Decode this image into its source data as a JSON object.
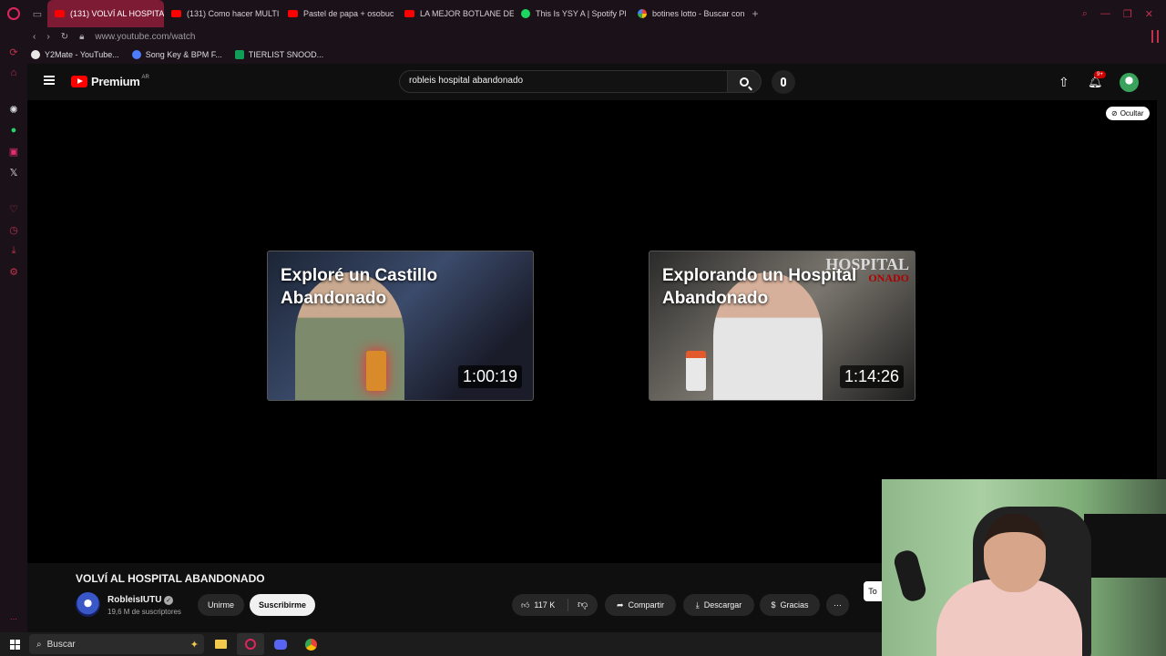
{
  "browser": {
    "tabs": [
      {
        "label": "(131) VOLVÍ AL HOSPITAL",
        "favicon": "youtube-icon",
        "active": true
      },
      {
        "label": "(131) Como hacer MULTI",
        "favicon": "youtube-icon",
        "active": false
      },
      {
        "label": "Pastel de papa + osobuc",
        "favicon": "youtube-icon",
        "active": false
      },
      {
        "label": "LA MEJOR BOTLANE DE",
        "favicon": "youtube-icon",
        "active": false
      },
      {
        "label": "This Is YSY A | Spotify Pl",
        "favicon": "spotify-icon",
        "active": false
      },
      {
        "label": "botines lotto - Buscar con",
        "favicon": "google-icon",
        "active": false
      }
    ],
    "url": "www.youtube.com/watch",
    "bookmarks": [
      {
        "label": "Y2Mate - YouTube..."
      },
      {
        "label": "Song Key & BPM F..."
      },
      {
        "label": "TIERLIST SNOOD..."
      }
    ],
    "accent_color": "#c0304f"
  },
  "youtube": {
    "logo_text": "Premium",
    "country_code": "AR",
    "search_value": "robleis hospital abandonado",
    "notifications_badge": "9+",
    "hide_button_label": "Ocultar",
    "end_cards": [
      {
        "title": "Exploré un Castillo Abandonado",
        "duration": "1:00:19"
      },
      {
        "title": "Explorando un Hospital Abandonado",
        "duration": "1:14:26",
        "overlay_text": "HOSPITAL",
        "overlay_sub": "ONADO"
      }
    ],
    "video": {
      "title": "VOLVÍ AL HOSPITAL ABANDONADO",
      "channel": "RobleisIUTU",
      "subscribers": "19,6 M de suscriptores",
      "join_label": "Unirme",
      "subscribe_label": "Suscribirme",
      "likes": "117 K",
      "share_label": "Compartir",
      "download_label": "Descargar",
      "thanks_label": "Gracias",
      "side_chip": "To"
    }
  },
  "taskbar": {
    "search_placeholder": "Buscar"
  }
}
